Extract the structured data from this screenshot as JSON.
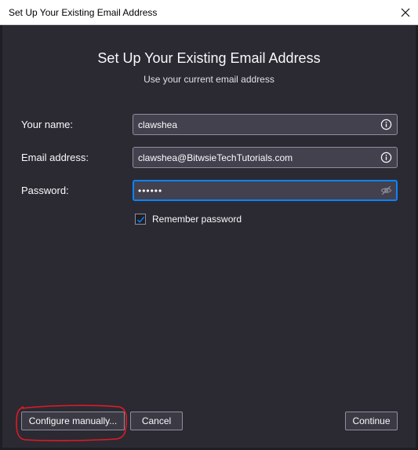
{
  "window": {
    "title": "Set Up Your Existing Email Address",
    "close_icon": "close-icon"
  },
  "heading": "Set Up Your Existing Email Address",
  "subheading": "Use your current email address",
  "form": {
    "name": {
      "label": "Your name:",
      "value": "clawshea",
      "icon": "info-icon"
    },
    "email": {
      "label": "Email address:",
      "value": "clawshea@BitwsieTechTutorials.com",
      "icon": "info-icon"
    },
    "password": {
      "label": "Password:",
      "value": "••••••",
      "icon": "eye-slash-icon"
    },
    "remember": {
      "label": "Remember password",
      "checked": true
    }
  },
  "buttons": {
    "configure": "Configure manually...",
    "cancel": "Cancel",
    "continue": "Continue"
  },
  "annotation": {
    "color": "#e01b24"
  },
  "colors": {
    "background": "#2b2a33",
    "field_bg": "#42414d",
    "focus": "#0a84ff"
  }
}
